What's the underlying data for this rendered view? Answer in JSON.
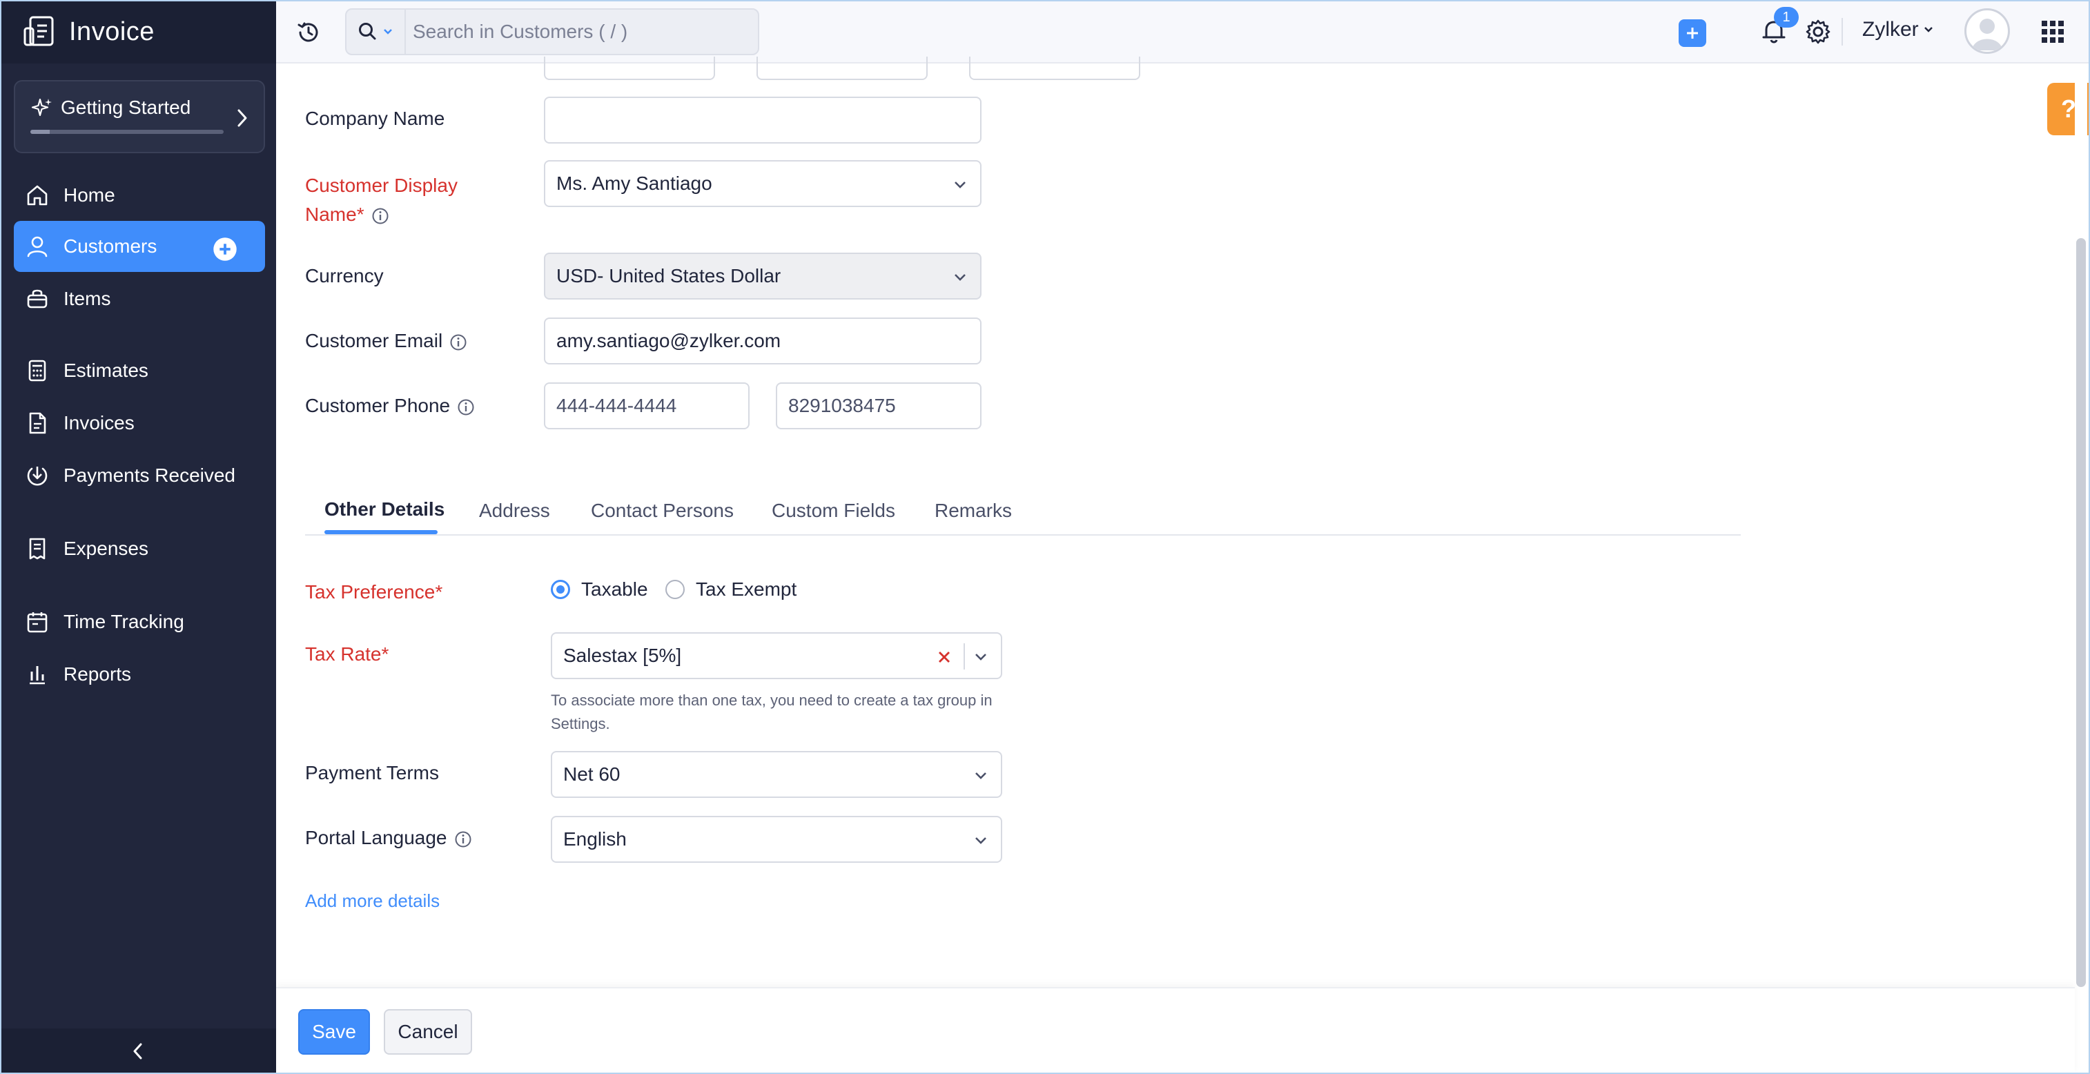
{
  "app": {
    "name": "Invoice"
  },
  "sidebar": {
    "getting_started": {
      "label": "Getting Started",
      "progress": 0.1
    },
    "items": [
      {
        "label": "Home",
        "icon": "home-icon"
      },
      {
        "label": "Customers",
        "icon": "user-icon",
        "active": true
      },
      {
        "label": "Items",
        "icon": "basket-icon"
      },
      {
        "label": "Estimates",
        "icon": "calculator-icon"
      },
      {
        "label": "Invoices",
        "icon": "document-icon"
      },
      {
        "label": "Payments Received",
        "icon": "download-circle-icon"
      },
      {
        "label": "Expenses",
        "icon": "receipt-icon"
      },
      {
        "label": "Time Tracking",
        "icon": "calendar-icon"
      },
      {
        "label": "Reports",
        "icon": "bar-chart-icon"
      }
    ]
  },
  "topbar": {
    "search_placeholder": "Search in Customers ( / )",
    "notification_count": "1",
    "org_name": "Zylker"
  },
  "form": {
    "company_name": {
      "label": "Company Name",
      "value": ""
    },
    "display_name": {
      "label_line1": "Customer Display",
      "label_line2": "Name*",
      "value": "Ms. Amy Santiago"
    },
    "currency": {
      "label": "Currency",
      "value": "USD- United States Dollar"
    },
    "email": {
      "label": "Customer Email",
      "value": "amy.santiago@zylker.com"
    },
    "phone": {
      "label": "Customer Phone",
      "work": "444-444-4444",
      "mobile": "8291038475"
    }
  },
  "tabs": [
    "Other Details",
    "Address",
    "Contact Persons",
    "Custom Fields",
    "Remarks"
  ],
  "other_details": {
    "tax_preference": {
      "label": "Tax Preference*",
      "options": [
        "Taxable",
        "Tax Exempt"
      ],
      "selected": "Taxable"
    },
    "tax_rate": {
      "label": "Tax Rate*",
      "value": "Salestax [5%]",
      "helper": "To associate more than one tax, you need to create a tax group in Settings."
    },
    "payment_terms": {
      "label": "Payment Terms",
      "value": "Net 60"
    },
    "portal_language": {
      "label": "Portal Language",
      "value": "English"
    },
    "add_more": "Add more details"
  },
  "footer": {
    "save": "Save",
    "cancel": "Cancel"
  },
  "help": {
    "label": "?"
  },
  "colors": {
    "accent": "#408dfb",
    "sidebar": "#21263c",
    "required": "#d6322d",
    "help": "#f79a34"
  }
}
